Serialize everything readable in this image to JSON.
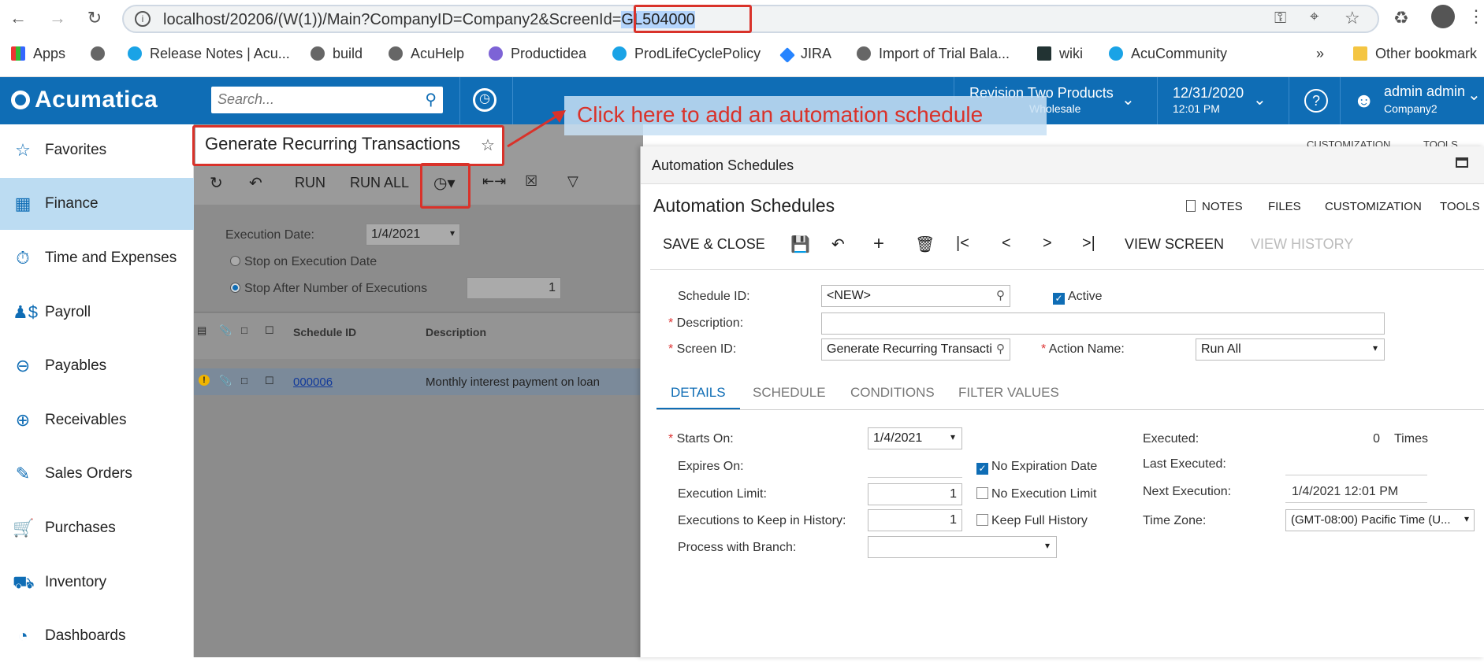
{
  "browser": {
    "url_prefix": "localhost/20206/(W(1))/Main?CompanyID=Company2&ScreenId=",
    "url_highlight": "GL504000",
    "bookmarks": [
      "Apps",
      "Release Notes | Acu...",
      "build",
      "AcuHelp",
      "Productidea",
      "ProdLifeCyclePolicy",
      "JIRA",
      "Import of Trial Bala...",
      "wiki",
      "AcuCommunity"
    ],
    "more": "»",
    "other_bookmarks": "Other bookmark"
  },
  "header": {
    "logo": "Acumatica",
    "search_placeholder": "Search...",
    "company_line1": "Revision Two Products",
    "company_line2": "Wholesale",
    "date": "12/31/2020",
    "time": "12:01 PM",
    "user_name": "admin admin",
    "user_company": "Company2"
  },
  "sidebar": {
    "items": [
      {
        "label": "Favorites",
        "icon": "star-icon"
      },
      {
        "label": "Finance",
        "icon": "calculator-icon"
      },
      {
        "label": "Time and Expenses",
        "icon": "stopwatch-icon"
      },
      {
        "label": "Payroll",
        "icon": "payroll-icon"
      },
      {
        "label": "Payables",
        "icon": "minus-circle-icon"
      },
      {
        "label": "Receivables",
        "icon": "plus-circle-icon"
      },
      {
        "label": "Sales Orders",
        "icon": "edit-icon"
      },
      {
        "label": "Purchases",
        "icon": "cart-icon"
      },
      {
        "label": "Inventory",
        "icon": "truck-icon"
      },
      {
        "label": "Dashboards",
        "icon": "gauge-icon"
      }
    ]
  },
  "page": {
    "title": "Generate Recurring Transactions",
    "toolbar": {
      "run": "RUN",
      "run_all": "RUN ALL"
    },
    "execution_date_label": "Execution Date:",
    "execution_date": "1/4/2021",
    "stop_on_date": "Stop on Execution Date",
    "stop_after": "Stop After Number of Executions",
    "stop_after_value": "1",
    "table": {
      "headers": [
        "Schedule ID",
        "Description"
      ],
      "rows": [
        {
          "id": "000006",
          "description": "Monthly interest payment on loan"
        }
      ]
    },
    "top_right": [
      "CUSTOMIZATION",
      "TOOLS"
    ]
  },
  "callout": "Click here to add an automation schedule",
  "dialog": {
    "window_title": "Automation Schedules",
    "title": "Automation Schedules",
    "links": [
      "NOTES",
      "FILES",
      "CUSTOMIZATION",
      "TOOLS"
    ],
    "toolbar": {
      "save_close": "SAVE & CLOSE",
      "view_screen": "VIEW SCREEN",
      "view_history": "VIEW HISTORY"
    },
    "fields": {
      "schedule_id_label": "Schedule ID:",
      "schedule_id": "<NEW>",
      "active_label": "Active",
      "description_label": "Description:",
      "description": "",
      "screen_id_label": "Screen ID:",
      "screen_id": "Generate Recurring Transacti",
      "action_name_label": "Action Name:",
      "action_name": "Run All"
    },
    "tabs": [
      "DETAILS",
      "SCHEDULE",
      "CONDITIONS",
      "FILTER VALUES"
    ],
    "details": {
      "starts_on_label": "Starts On:",
      "starts_on": "1/4/2021",
      "expires_on_label": "Expires On:",
      "no_expiration": "No Expiration Date",
      "exec_limit_label": "Execution Limit:",
      "exec_limit": "1",
      "no_exec_limit": "No Execution Limit",
      "keep_history_label": "Executions to Keep in History:",
      "keep_history": "1",
      "keep_full_history": "Keep Full History",
      "branch_label": "Process with Branch:",
      "executed_label": "Executed:",
      "executed": "0",
      "times": "Times",
      "last_executed_label": "Last Executed:",
      "next_execution_label": "Next Execution:",
      "next_execution": "1/4/2021 12:01 PM",
      "time_zone_label": "Time Zone:",
      "time_zone": "(GMT-08:00) Pacific Time (U..."
    }
  }
}
